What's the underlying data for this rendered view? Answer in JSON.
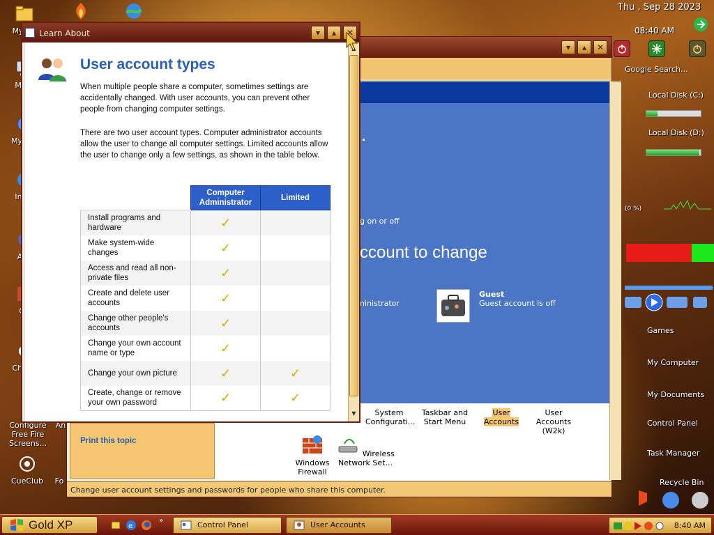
{
  "desktop": {
    "icons": [
      {
        "label": "My Do"
      },
      {
        "label": "My C"
      },
      {
        "label": "My N P"
      },
      {
        "label": "In Ex"
      },
      {
        "label": "Alie"
      },
      {
        "label": "CC"
      },
      {
        "label": "Ch Inv"
      },
      {
        "label": "Configure Free Fire Screens..."
      },
      {
        "label": "An"
      },
      {
        "label": "CueClub"
      },
      {
        "label": "Fo"
      }
    ]
  },
  "sidepanel": {
    "date": "Thu , Sep 28 2023",
    "time": "08:40 AM",
    "search_placeholder": "Google Search...",
    "disks": [
      {
        "label": "Local Disk (C:)",
        "used_fraction": 0.2
      },
      {
        "label": "Local Disk (D:)",
        "used_fraction": 0.97
      }
    ],
    "cpu": "(0 %)",
    "links": [
      "Games",
      "My Computer",
      "My Documents",
      "Control Panel",
      "Task Manager",
      "Recycle Bin"
    ]
  },
  "ua_window": {
    "partial_heading": "ccount to change",
    "partial_onoff": "g on or off",
    "partial_admin": "ninistrator",
    "guest": {
      "name": "Guest",
      "status": "Guest account is off"
    },
    "cpl_items": [
      {
        "label": "System Configurati..."
      },
      {
        "label": "Taskbar and Start Menu"
      },
      {
        "label": "User Accounts"
      },
      {
        "label": "User Accounts (W2k)"
      },
      {
        "label": "Windows Firewall"
      },
      {
        "label": "Wireless Network Set..."
      }
    ],
    "status_text": "Change user account settings and passwords for people who share this computer."
  },
  "learn_window": {
    "title": "Learn About",
    "heading": "User account types",
    "para1": "When multiple people share a computer, sometimes settings are accidentally changed. With user accounts, you can prevent other people from changing computer settings.",
    "para2": "There are two user account types. Computer administrator accounts allow the user to change all computer settings. Limited accounts allow the user to change only a few settings, as shown in the table below.",
    "table": {
      "headers": [
        "Computer Administrator",
        "Limited"
      ],
      "rows": [
        {
          "label": "Install programs and hardware",
          "admin": "✓",
          "limited": ""
        },
        {
          "label": "Make system-wide changes",
          "admin": "✓",
          "limited": ""
        },
        {
          "label": "Access and read all non-private files",
          "admin": "✓",
          "limited": ""
        },
        {
          "label": "Create and delete user accounts",
          "admin": "✓",
          "limited": ""
        },
        {
          "label": "Change other people's accounts",
          "admin": "✓",
          "limited": ""
        },
        {
          "label": "Change your own account name or type",
          "admin": "✓",
          "limited": ""
        },
        {
          "label": "Change your own picture",
          "admin": "✓",
          "limited": "✓"
        },
        {
          "label": "Create, change or remove your own password",
          "admin": "✓",
          "limited": "✓"
        }
      ]
    },
    "print_link": "Print this topic"
  },
  "taskbar": {
    "start_label": "Gold XP",
    "tasks": [
      {
        "label": "Control Panel"
      },
      {
        "label": "User Accounts"
      }
    ],
    "clock": "8:40 AM"
  },
  "colors": {
    "accent_blue": "#2c60c8",
    "title_bar": "#6a1e10",
    "gold": "#f6c670"
  }
}
